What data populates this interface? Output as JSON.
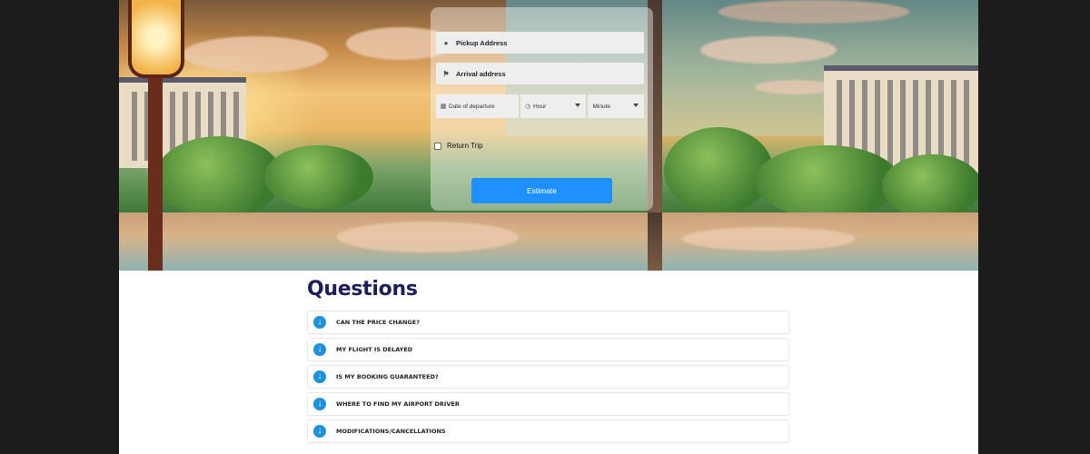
{
  "form": {
    "pickup": {
      "placeholder": "Pickup Address",
      "icon": "map-pin-icon"
    },
    "arrival": {
      "placeholder": "Arrival address",
      "icon": "flag-icon"
    },
    "date": {
      "placeholder": "Date of departure",
      "icon": "calendar-icon"
    },
    "hour": {
      "selected": "Hour",
      "icon": "clock-icon"
    },
    "minute": {
      "selected": "Minute"
    },
    "return_trip_label": "Return Trip",
    "return_trip_checked": false,
    "estimate_label": "Estimate"
  },
  "questions": {
    "title": "Questions",
    "items": [
      {
        "label": "CAN THE PRICE CHANGE?"
      },
      {
        "label": "MY FLIGHT IS DELAYED"
      },
      {
        "label": "IS MY BOOKING GUARANTEED?"
      },
      {
        "label": "WHERE TO FIND MY AIRPORT DRIVER"
      },
      {
        "label": "MODIFICATIONS/CANCELLATIONS"
      }
    ]
  },
  "colors": {
    "accent": "#1e90ff",
    "heading": "#1e1e5a",
    "page_bg": "#1c1c1c"
  }
}
